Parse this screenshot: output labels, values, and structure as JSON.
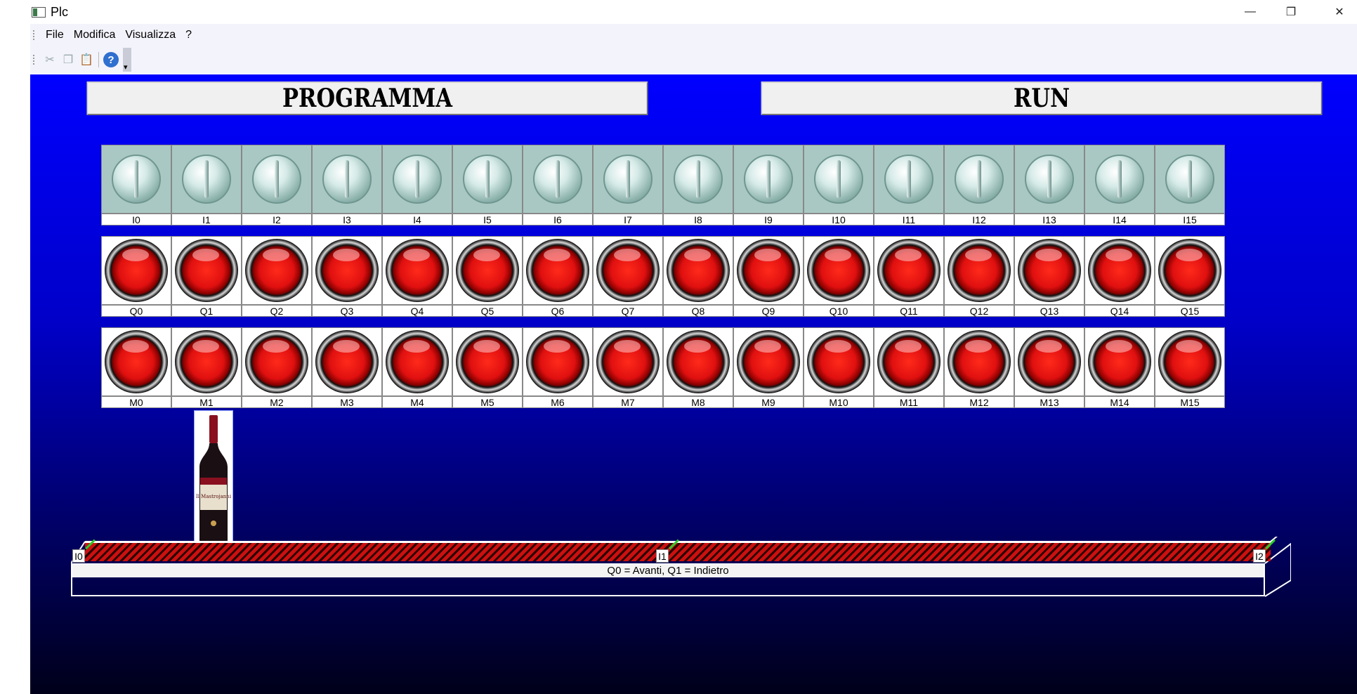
{
  "window": {
    "title": "Plc",
    "minimize": "—",
    "restore": "❐",
    "close": "✕"
  },
  "menu": [
    "File",
    "Modifica",
    "Visualizza",
    "?"
  ],
  "toolbar": {
    "cut_icon": "cut-icon",
    "copy_icon": "copy-icon",
    "paste_icon": "paste-icon",
    "help_label": "?"
  },
  "buttons": {
    "programma": "PROGRAMMA",
    "run": "RUN"
  },
  "inputs": [
    "I0",
    "I1",
    "I2",
    "I3",
    "I4",
    "I5",
    "I6",
    "I7",
    "I8",
    "I9",
    "I10",
    "I11",
    "I12",
    "I13",
    "I14",
    "I15"
  ],
  "outputs": [
    "Q0",
    "Q1",
    "Q2",
    "Q3",
    "Q4",
    "Q5",
    "Q6",
    "Q7",
    "Q8",
    "Q9",
    "Q10",
    "Q11",
    "Q12",
    "Q13",
    "Q14",
    "Q15"
  ],
  "markers": [
    "M0",
    "M1",
    "M2",
    "M3",
    "M4",
    "M5",
    "M6",
    "M7",
    "M8",
    "M9",
    "M10",
    "M11",
    "M12",
    "M13",
    "M14",
    "M15"
  ],
  "conveyor": {
    "caption": "Q0 = Avanti, Q1 = Indietro",
    "sensors": [
      "I0",
      "I1",
      "I2"
    ],
    "bottle_label": "Il Mastrojanni"
  },
  "colors": {
    "background_top": "#0000ff",
    "background_bottom": "#00001a",
    "belt_red": "#cc1010",
    "sensor_green": "#2ccd2c"
  }
}
